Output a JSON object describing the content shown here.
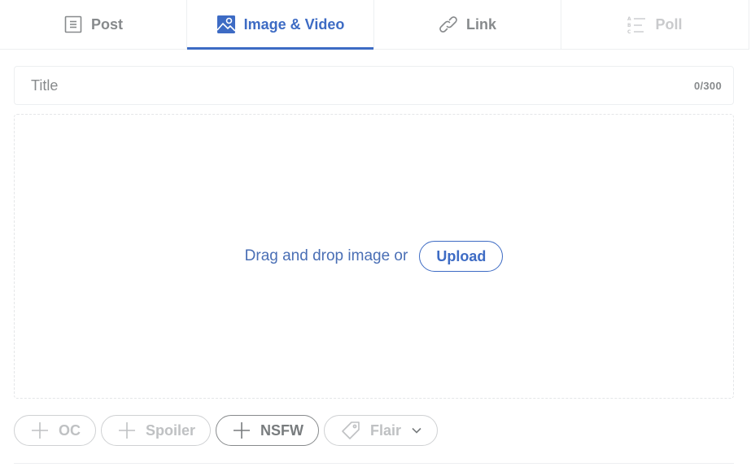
{
  "tabs": [
    {
      "label": "Post",
      "icon": "post-icon",
      "state": "normal"
    },
    {
      "label": "Image & Video",
      "icon": "image-icon",
      "state": "active"
    },
    {
      "label": "Link",
      "icon": "link-icon",
      "state": "normal"
    },
    {
      "label": "Poll",
      "icon": "poll-icon",
      "state": "disabled"
    }
  ],
  "title_field": {
    "placeholder": "Title",
    "value": "",
    "char_count": "0/300"
  },
  "dropzone": {
    "text": "Drag and drop image or",
    "upload_label": "Upload"
  },
  "tags": [
    {
      "label": "OC",
      "icon": "plus-icon",
      "enabled": false
    },
    {
      "label": "Spoiler",
      "icon": "plus-icon",
      "enabled": false
    },
    {
      "label": "NSFW",
      "icon": "plus-icon",
      "enabled": true
    },
    {
      "label": "Flair",
      "icon": "tag-icon",
      "enabled": false
    }
  ],
  "colors": {
    "accent": "#3d6bc4",
    "muted": "#878a8c",
    "disabled": "#c9cacc",
    "border": "#edeff1"
  }
}
